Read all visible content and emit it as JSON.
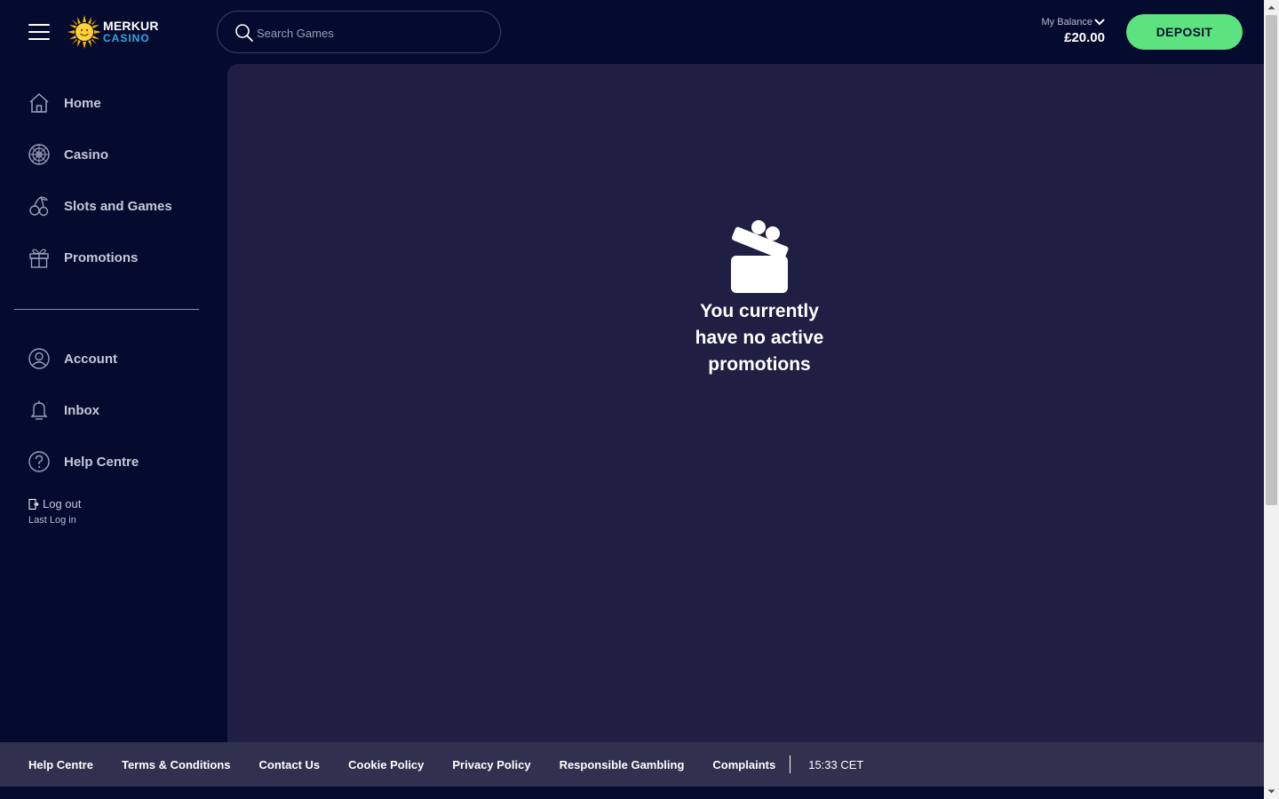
{
  "header": {
    "logo_top": "MERKUR",
    "logo_bottom": "CASINO",
    "search_placeholder": "Search Games",
    "balance_label": "My Balance",
    "balance_amount": "£20.00",
    "deposit_label": "DEPOSIT"
  },
  "sidebar": {
    "items": [
      {
        "label": "Home",
        "icon": "home-icon"
      },
      {
        "label": "Casino",
        "icon": "roulette-icon"
      },
      {
        "label": "Slots and Games",
        "icon": "cherries-icon"
      },
      {
        "label": "Promotions",
        "icon": "gift-icon"
      }
    ],
    "account_items": [
      {
        "label": "Account",
        "icon": "user-icon"
      },
      {
        "label": "Inbox",
        "icon": "bell-icon"
      },
      {
        "label": "Help Centre",
        "icon": "help-icon"
      }
    ],
    "logout_label": "Log out",
    "last_login_label": "Last Log in"
  },
  "main": {
    "empty_message": "You currently have no active promotions"
  },
  "footer": {
    "links": [
      "Help Centre",
      "Terms & Conditions",
      "Contact Us",
      "Cookie Policy",
      "Privacy Policy",
      "Responsible Gambling",
      "Complaints"
    ],
    "time": "15:33 CET"
  },
  "colors": {
    "background": "#050b2e",
    "content": "#1e1f42",
    "accent": "#5ce37f",
    "footer": "#30304f"
  }
}
